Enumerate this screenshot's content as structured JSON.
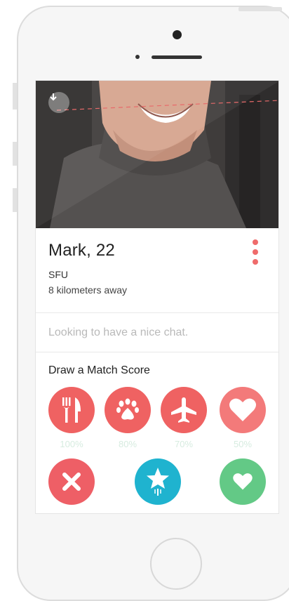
{
  "profile": {
    "name_age": "Mark, 22",
    "school": "SFU",
    "distance": "8 kilometers away",
    "bio": "Looking to have a nice chat."
  },
  "match_score": {
    "title": "Draw a Match Score",
    "categories": [
      {
        "icon": "fork-knife-icon",
        "percent_label": "100%",
        "color": "#ef6262"
      },
      {
        "icon": "paw-icon",
        "percent_label": "80%",
        "color": "#ef6262"
      },
      {
        "icon": "airplane-icon",
        "percent_label": "70%",
        "color": "#ef6262"
      },
      {
        "icon": "heart-icon",
        "percent_label": "50%",
        "color": "#f37a7a"
      }
    ]
  },
  "actions": {
    "nope": {
      "icon": "close-icon",
      "color": "#ee5f66"
    },
    "super_like": {
      "icon": "star-icon",
      "color": "#1fb3cf"
    },
    "like": {
      "icon": "heart-icon",
      "color": "#63c986"
    }
  },
  "colors": {
    "accent": "#ef6b6b",
    "pct_text": "#d7ece0"
  }
}
